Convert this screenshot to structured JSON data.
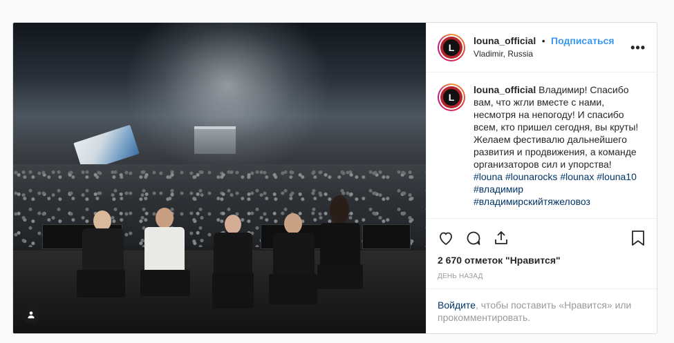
{
  "post": {
    "username": "louna_official",
    "follow_label": "Подписаться",
    "separator": "•",
    "location": "Vladimir, Russia",
    "more_label": "•••",
    "avatar_letter": "L",
    "caption": {
      "username": "louna_official",
      "text": "Владимир! Спасибо вам, что жгли вместе с нами, несмотря на непогоду! И спасибо всем, кто пришел сегодня, вы круты! Желаем фестивалю дальнейшего развития и продвижения, а команде организаторов сил и упорства!",
      "hashtags_line1": [
        "#louna",
        "#lounarocks",
        "#lounax",
        "#louna10"
      ],
      "hashtags_line2": "#владимир",
      "hashtags_line3": "#владимирскийтяжеловоз"
    },
    "likes": "2 670 отметок \"Нравится\"",
    "time": "ДЕНЬ НАЗАД",
    "login_link": "Войдите",
    "login_text": ", чтобы поставить «Нравится» или прокомментировать."
  },
  "icons": {
    "like": "heart-icon",
    "comment": "comment-icon",
    "share": "share-icon",
    "save": "bookmark-icon",
    "tag": "user-tag-icon"
  }
}
